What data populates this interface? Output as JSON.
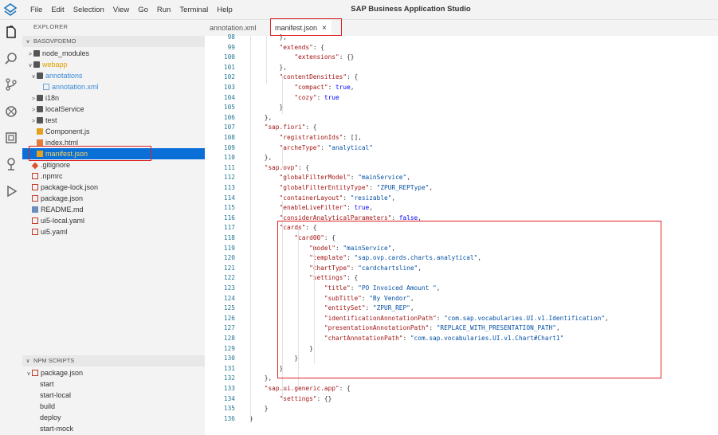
{
  "app": {
    "title": "SAP Business Application Studio",
    "menu": [
      "File",
      "Edit",
      "Selection",
      "View",
      "Go",
      "Run",
      "Terminal",
      "Help"
    ]
  },
  "sidebar": {
    "explorer_label": "EXPLORER",
    "project_label": "BASOVPDEMO",
    "npm_label": "NPM SCRIPTS",
    "tree": [
      {
        "label": "node_modules"
      },
      {
        "label": "webapp"
      },
      {
        "label": "annotations"
      },
      {
        "label": "annotation.xml"
      },
      {
        "label": "i18n"
      },
      {
        "label": "localService"
      },
      {
        "label": "test"
      },
      {
        "label": "Component.js"
      },
      {
        "label": "index.html"
      },
      {
        "label": "manifest.json"
      },
      {
        "label": ".gitignore"
      },
      {
        "label": ".npmrc"
      },
      {
        "label": "package-lock.json"
      },
      {
        "label": "package.json"
      },
      {
        "label": "README.md"
      },
      {
        "label": "ui5-local.yaml"
      },
      {
        "label": "ui5.yaml"
      }
    ],
    "npm_package": "package.json",
    "npm_scripts": [
      "start",
      "start-local",
      "build",
      "deploy",
      "start-mock"
    ]
  },
  "tabs": [
    {
      "label": "annotation.xml"
    },
    {
      "label": "manifest.json",
      "close": "×"
    }
  ],
  "editor": {
    "lines": [
      {
        "n": "98",
        "t": "        },"
      },
      {
        "n": "99",
        "t": "        \"extends\": {"
      },
      {
        "n": "100",
        "t": "            \"extensions\": {}"
      },
      {
        "n": "101",
        "t": "        },"
      },
      {
        "n": "102",
        "t": "        \"contentDensities\": {"
      },
      {
        "n": "103",
        "t": "            \"compact\": true,"
      },
      {
        "n": "104",
        "t": "            \"cozy\": true"
      },
      {
        "n": "105",
        "t": "        }"
      },
      {
        "n": "106",
        "t": "    },"
      },
      {
        "n": "107",
        "t": "    \"sap.fiori\": {"
      },
      {
        "n": "108",
        "t": "        \"registrationIds\": [],"
      },
      {
        "n": "109",
        "t": "        \"archeType\": \"analytical\""
      },
      {
        "n": "110",
        "t": "    },"
      },
      {
        "n": "111",
        "t": "    \"sap.ovp\": {"
      },
      {
        "n": "112",
        "t": "        \"globalFilterModel\": \"mainService\","
      },
      {
        "n": "113",
        "t": "        \"globalFilterEntityType\": \"ZPUR_REPType\","
      },
      {
        "n": "114",
        "t": "        \"containerLayout\": \"resizable\","
      },
      {
        "n": "115",
        "t": "        \"enableLiveFilter\": true,"
      },
      {
        "n": "116",
        "t": "        \"considerAnalyticalParameters\": false,"
      },
      {
        "n": "117",
        "t": "        \"cards\": {"
      },
      {
        "n": "118",
        "t": "            \"card00\": {"
      },
      {
        "n": "119",
        "t": "                \"model\": \"mainService\","
      },
      {
        "n": "120",
        "t": "                \"template\": \"sap.ovp.cards.charts.analytical\","
      },
      {
        "n": "121",
        "t": "                \"chartType\": \"cardchartsline\","
      },
      {
        "n": "122",
        "t": "                \"settings\": {"
      },
      {
        "n": "123",
        "t": "                    \"title\": \"PO Invoiced Amount \","
      },
      {
        "n": "124",
        "t": "                    \"subTitle\": \"By Vendor\","
      },
      {
        "n": "125",
        "t": "                    \"entitySet\": \"ZPUR_REP\","
      },
      {
        "n": "126",
        "t": "                    \"identificationAnnotationPath\": \"com.sap.vocabularies.UI.v1.Identification\","
      },
      {
        "n": "127",
        "t": "                    \"presentationAnnotationPath\": \"REPLACE_WITH_PRESENTATION_PATH\","
      },
      {
        "n": "128",
        "t": "                    \"chartAnnotationPath\": \"com.sap.vocabularies.UI.v1.Chart#Chart1\""
      },
      {
        "n": "129",
        "t": "                }"
      },
      {
        "n": "130",
        "t": "            }"
      },
      {
        "n": "131",
        "t": "        }"
      },
      {
        "n": "132",
        "t": "    },"
      },
      {
        "n": "133",
        "t": "    \"sap.ui.generic.app\": {"
      },
      {
        "n": "134",
        "t": "        \"settings\": {}"
      },
      {
        "n": "135",
        "t": "    }"
      },
      {
        "n": "136",
        "t": "}"
      }
    ]
  }
}
